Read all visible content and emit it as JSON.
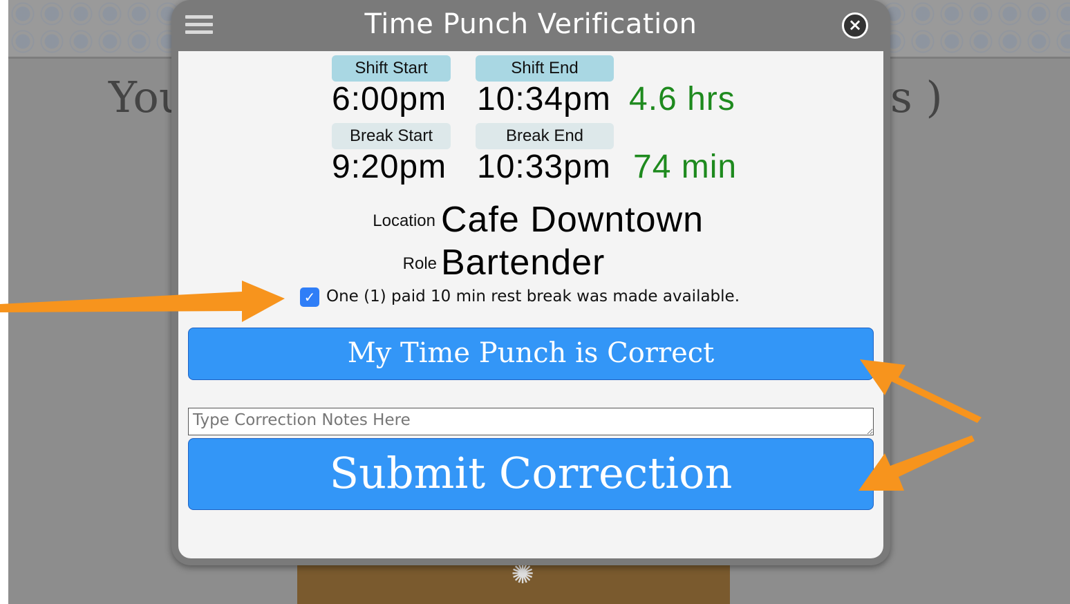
{
  "background": {
    "heading_left": "You",
    "heading_right": "s )"
  },
  "modal": {
    "title": "Time Punch Verification",
    "close_symbol": "×",
    "shift": {
      "start_label": "Shift Start",
      "end_label": "Shift End",
      "start_time": "6:00pm",
      "end_time": "10:34pm",
      "duration": "4.6 hrs"
    },
    "break": {
      "start_label": "Break Start",
      "end_label": "Break End",
      "start_time": "9:20pm",
      "end_time": "10:33pm",
      "duration": "74 min"
    },
    "location_label": "Location",
    "location_value": "Cafe Downtown",
    "role_label": "Role",
    "role_value": "Bartender",
    "rest_break_checked": true,
    "rest_break_text": "One (1) paid 10 min rest break was made available.",
    "correct_button": "My Time Punch is Correct",
    "notes_placeholder": "Type Correction Notes Here",
    "notes_value": "",
    "submit_button": "Submit Correction"
  },
  "colors": {
    "accent_button": "#3396f7",
    "duration_green": "#1e8a1e",
    "shift_pill": "#a9d7e3",
    "break_pill": "#dde8ea",
    "annotation_arrow": "#f7941d"
  },
  "icons": {
    "menu": "hamburger-icon",
    "close": "close-icon",
    "checkbox": "checkmark-icon"
  }
}
